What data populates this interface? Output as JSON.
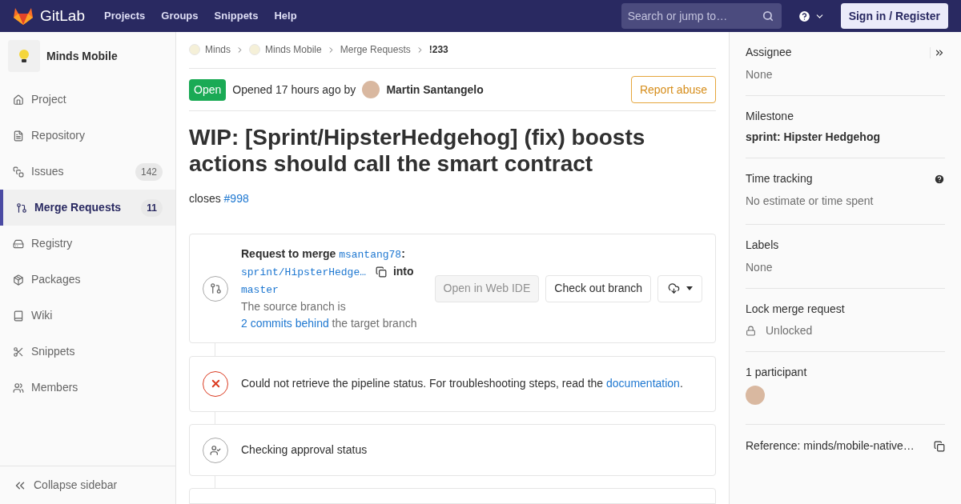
{
  "navbar": {
    "brand": "GitLab",
    "links": [
      "Projects",
      "Groups",
      "Snippets",
      "Help"
    ],
    "search": {
      "placeholder": "Search or jump to…"
    },
    "signin": "Sign in / Register"
  },
  "sidebar": {
    "project": "Minds Mobile",
    "items": [
      {
        "label": "Project",
        "selected": false
      },
      {
        "label": "Repository",
        "selected": false
      },
      {
        "label": "Issues",
        "count": "142",
        "selected": false
      },
      {
        "label": "Merge Requests",
        "count": "11",
        "selected": true
      },
      {
        "label": "Registry",
        "selected": false
      },
      {
        "label": "Packages",
        "selected": false
      },
      {
        "label": "Wiki",
        "selected": false
      },
      {
        "label": "Snippets",
        "selected": false
      },
      {
        "label": "Members",
        "selected": false
      }
    ],
    "collapse": "Collapse sidebar"
  },
  "breadcrumbs": [
    {
      "label": "Minds",
      "avatar": true,
      "current": false
    },
    {
      "label": "Minds Mobile",
      "avatar": true,
      "current": false
    },
    {
      "label": "Merge Requests",
      "avatar": false,
      "current": false
    },
    {
      "label": "!233",
      "avatar": false,
      "current": true
    }
  ],
  "header": {
    "status": "Open",
    "opened": "Opened 17 hours ago by",
    "author": "Martin Santangelo",
    "report": "Report abuse"
  },
  "title": "WIP: [Sprint/HipsterHedgehog] (fix) boosts actions should call the smart contract",
  "description": {
    "text": "closes",
    "link": "#998"
  },
  "merge_widget": {
    "prefix": "Request to merge",
    "source_user": "msantang78",
    "colon": ":",
    "source_branch": "sprint/HipsterHedge…",
    "into": "into",
    "target": "master",
    "behind_prefix": "The source branch is",
    "behind_link": "2 commits behind",
    "behind_suffix": "the target branch",
    "open_ide": "Open in Web IDE",
    "checkout": "Check out branch"
  },
  "pipeline": {
    "text": "Could not retrieve the pipeline status. For troubleshooting steps, read the",
    "link": "documentation",
    "end": "."
  },
  "approval": {
    "text": "Checking approval status"
  },
  "right_sidebar": {
    "assignee": {
      "label": "Assignee",
      "value": "None"
    },
    "milestone": {
      "label": "Milestone",
      "value": "sprint: Hipster Hedgehog"
    },
    "time": {
      "label": "Time tracking",
      "value": "No estimate or time spent"
    },
    "labels": {
      "label": "Labels",
      "value": "None"
    },
    "lock": {
      "label": "Lock merge request",
      "value": "Unlocked"
    },
    "participants": {
      "label": "1 participant"
    },
    "reference": "Reference: minds/mobile-native…"
  }
}
